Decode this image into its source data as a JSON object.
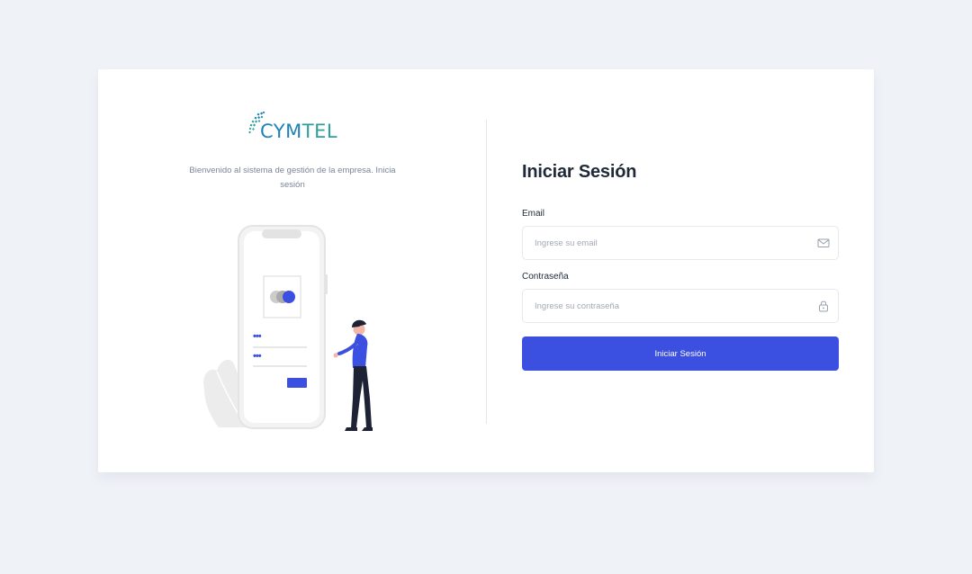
{
  "brand": {
    "logo_main": "CYM",
    "logo_accent": "TEL",
    "primary_color": "#1f83b8",
    "accent_color": "#2e9f9b"
  },
  "welcome_text": "Bienvenido al sistema de gestión de la empresa. Inicia sesión",
  "login": {
    "title": "Iniciar Sesión",
    "email_label": "Email",
    "email_placeholder": "Ingrese su email",
    "email_value": "",
    "email_icon": "mail-icon",
    "password_label": "Contraseña",
    "password_placeholder": "Ingrese su contraseña",
    "password_value": "",
    "password_icon": "lock-icon",
    "submit_label": "Iniciar Sesión",
    "submit_color": "#3b4fe0"
  },
  "illustration": {
    "password_dots_1": "•••",
    "password_dots_2": "•••",
    "accent_color": "#3b4fe0"
  }
}
